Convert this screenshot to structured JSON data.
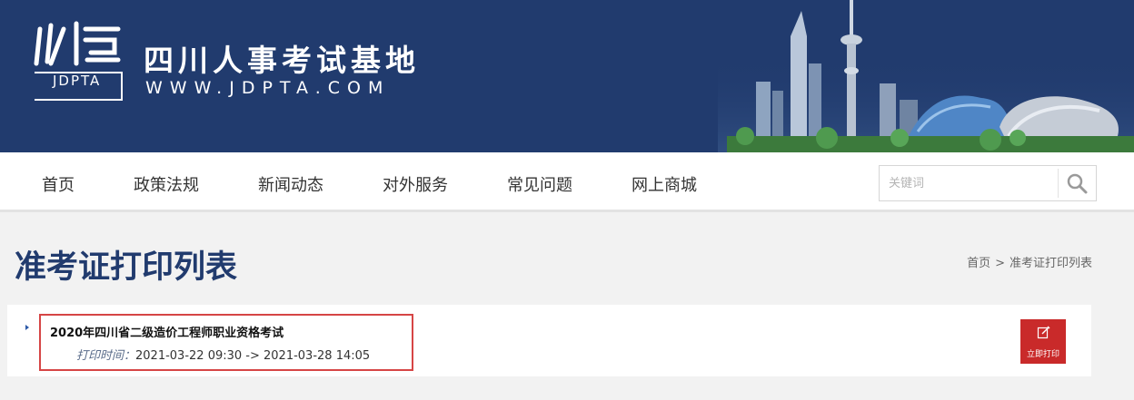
{
  "header": {
    "logo_code": "JDPTA",
    "site_name": "四川人事考试基地",
    "site_url": "WWW.JDPTA.COM",
    "brand_color": "#213b6e"
  },
  "nav": {
    "items": [
      {
        "label": "首页"
      },
      {
        "label": "政策法规"
      },
      {
        "label": "新闻动态"
      },
      {
        "label": "对外服务"
      },
      {
        "label": "常见问题"
      },
      {
        "label": "网上商城"
      }
    ],
    "search": {
      "placeholder": "关键词",
      "icon": "search-icon"
    }
  },
  "page": {
    "title": "准考证打印列表",
    "breadcrumb": [
      {
        "label": "首页"
      },
      {
        "label": "准考证打印列表"
      }
    ],
    "breadcrumb_separator": ">"
  },
  "list": {
    "items": [
      {
        "title": "2020年四川省二级造价工程师职业资格考试",
        "time_label": "打印时间：",
        "time_range": "2021-03-22 09:30 -> 2021-03-28 14:05",
        "action_label": "立即打印",
        "action_icon": "edit-icon",
        "action_color": "#c92a2a"
      }
    ]
  }
}
